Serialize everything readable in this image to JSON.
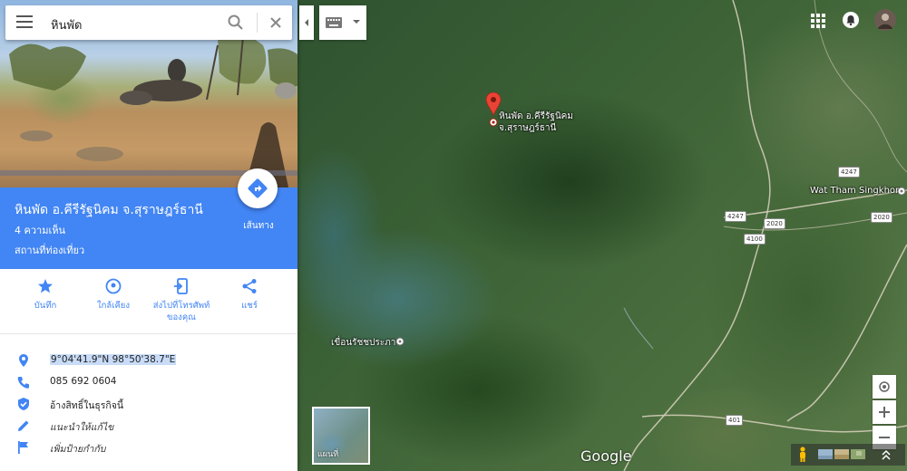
{
  "search": {
    "query": "หินพัด"
  },
  "place": {
    "title": "หินพัด อ.คีรีรัฐนิคม จ.สุราษฎร์ธานี",
    "reviews": "4 ความเห็น",
    "category": "สถานที่ท่องเที่ยว",
    "directions_label": "เส้นทาง"
  },
  "actions": [
    {
      "label": "บันทึก",
      "icon": "star-icon"
    },
    {
      "label": "ใกล้เคียง",
      "icon": "nearby-icon"
    },
    {
      "label": "ส่งไปที่โทรศัพท์ของคุณ",
      "icon": "send-to-phone-icon"
    },
    {
      "label": "แชร์",
      "icon": "share-icon"
    }
  ],
  "details": [
    {
      "text": "9°04'41.9\"N 98°50'38.7\"E",
      "icon": "location-pin-icon"
    },
    {
      "text": "085 692 0604",
      "icon": "phone-icon"
    },
    {
      "text": "อ้างสิทธิ์ในธุรกิจนี้",
      "icon": "verified-shield-icon"
    },
    {
      "text": "แนะนำให้แก้ไข",
      "icon": "edit-pencil-icon"
    },
    {
      "text": "เพิ่มป้ายกำกับ",
      "icon": "flag-icon"
    }
  ],
  "map": {
    "marker_label_line1": "หินพัด อ.คีรีรัฐนิคม",
    "marker_label_line2": "จ.สุราษฎร์ธานี",
    "dam_label": "เขื่อนรัชชประภา",
    "place_label": "Wat Tham Singkhon",
    "route_shields": [
      "4247",
      "4247",
      "2020",
      "2020",
      "4100",
      "401"
    ],
    "minimap_label": "แผนที่",
    "logo": "Google"
  },
  "colors": {
    "accent": "#4285f4",
    "marker": "#ea4335"
  }
}
